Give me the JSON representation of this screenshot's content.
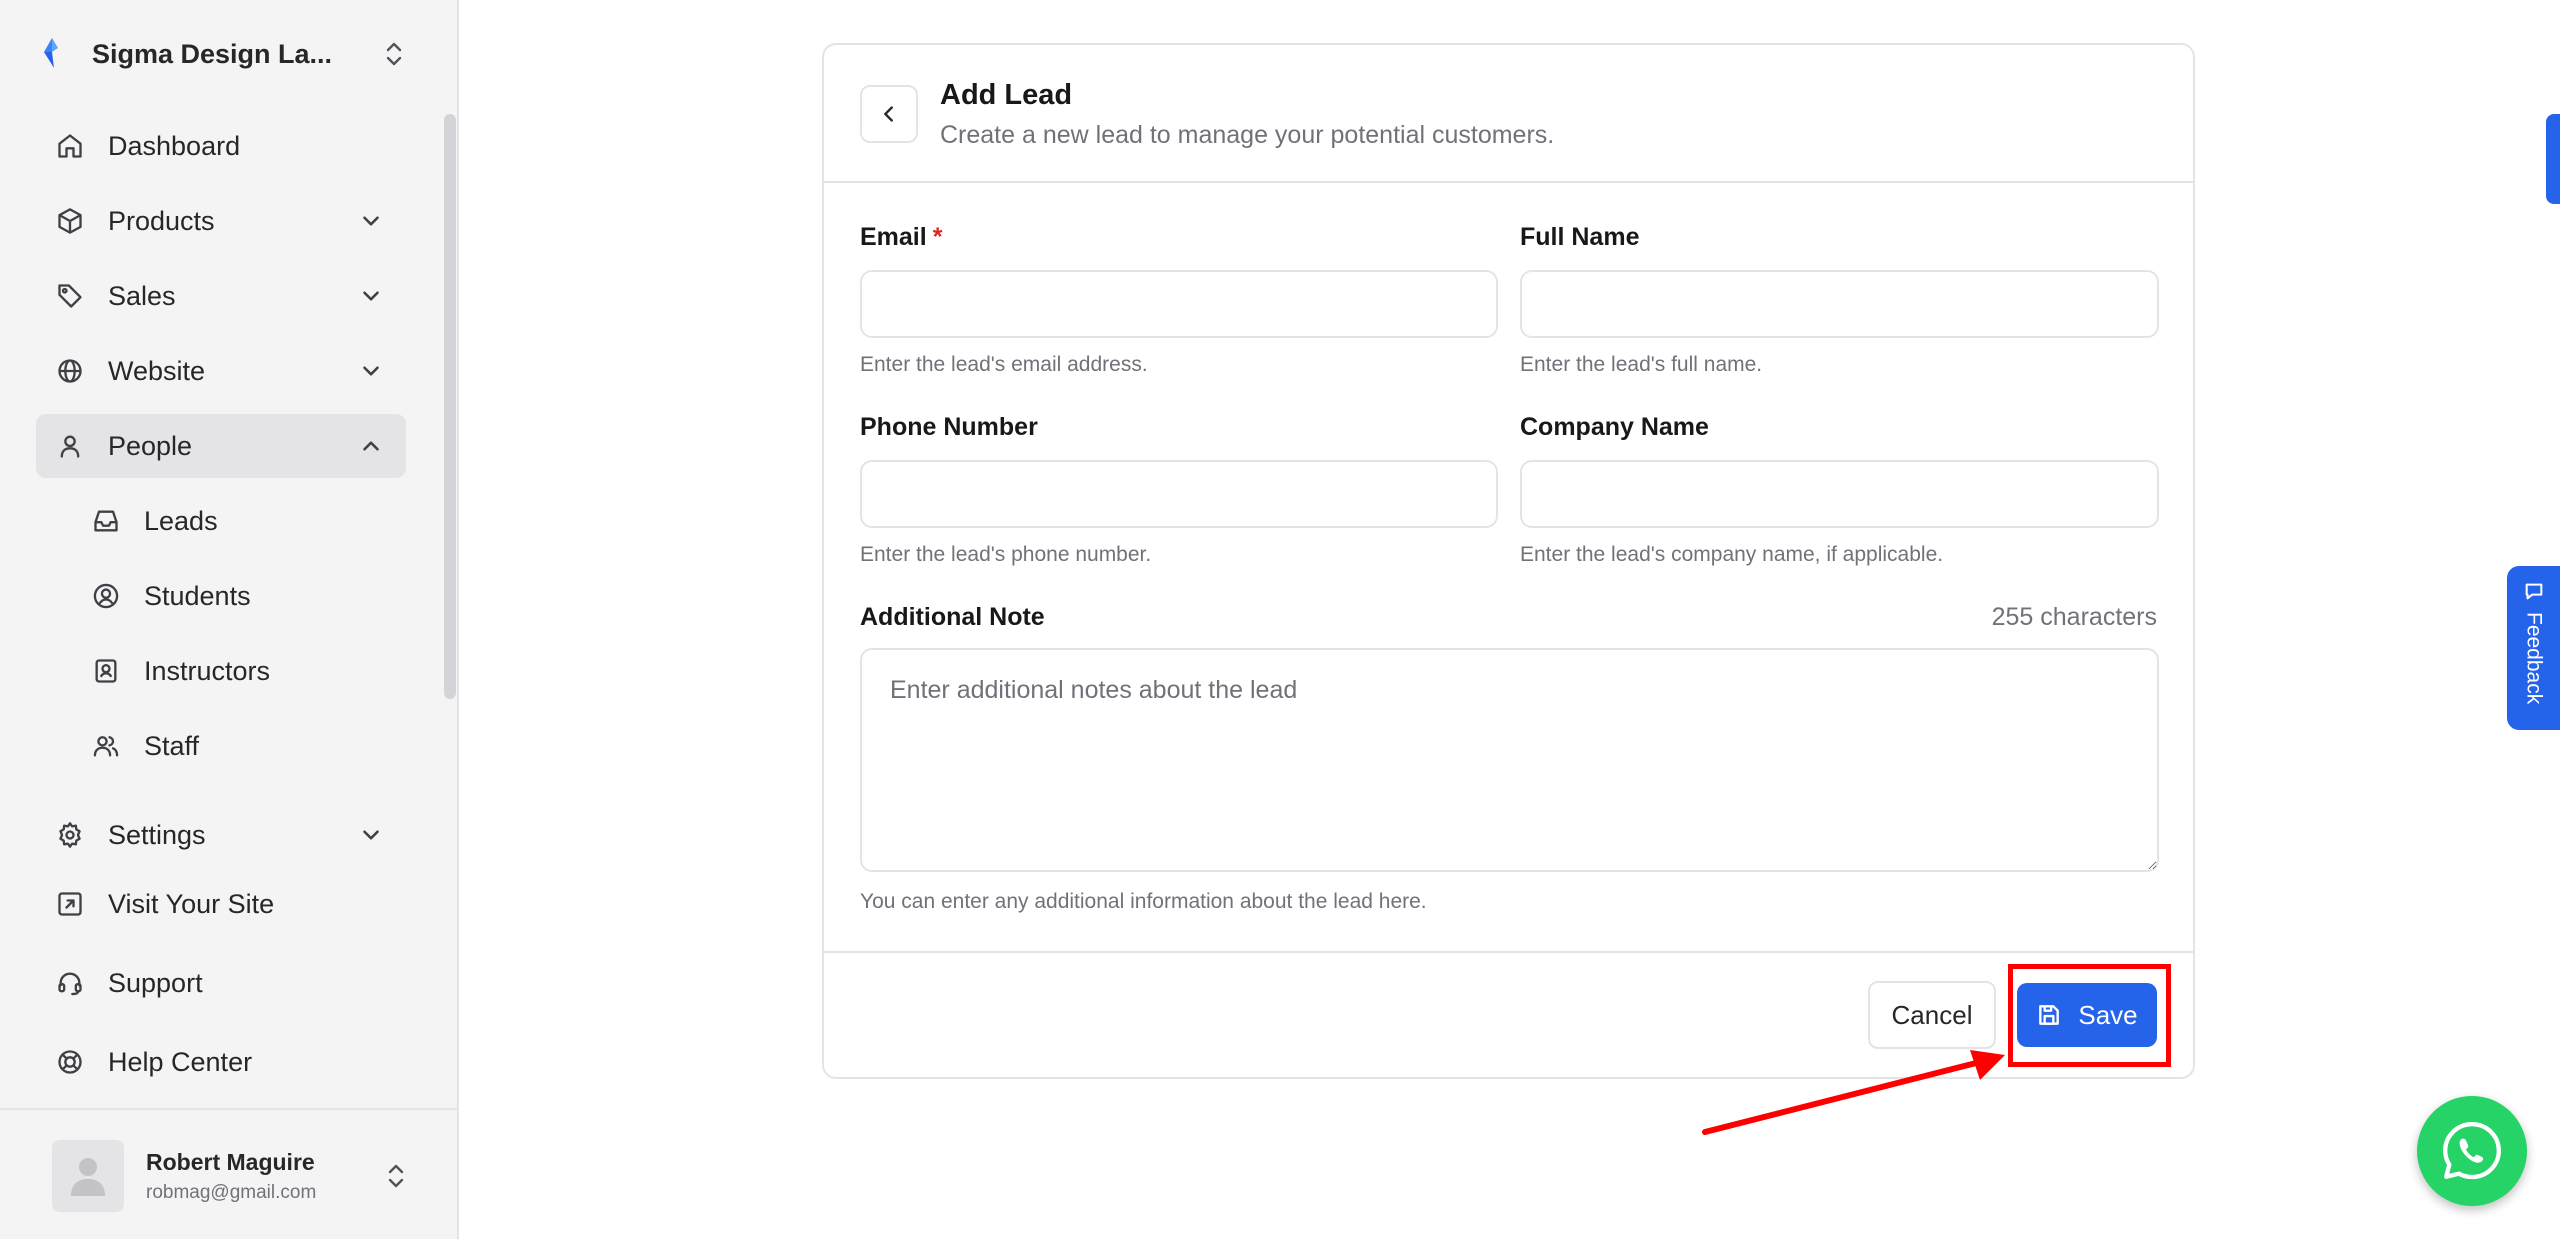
{
  "sidebar": {
    "org_name": "Sigma Design La...",
    "nav": {
      "dashboard": "Dashboard",
      "products": "Products",
      "sales": "Sales",
      "website": "Website",
      "people": "People",
      "leads": "Leads",
      "students": "Students",
      "instructors": "Instructors",
      "staff": "Staff",
      "settings": "Settings",
      "visit_site": "Visit Your Site",
      "support": "Support",
      "help_center": "Help Center"
    },
    "user": {
      "name": "Robert Maguire",
      "email": "robmag@gmail.com"
    }
  },
  "form": {
    "title": "Add Lead",
    "subtitle": "Create a new lead to manage your potential customers.",
    "email": {
      "label": "Email",
      "required_mark": "*",
      "value": "",
      "help": "Enter the lead's email address."
    },
    "full_name": {
      "label": "Full Name",
      "value": "",
      "help": "Enter the lead's full name."
    },
    "phone": {
      "label": "Phone Number",
      "value": "",
      "help": "Enter the lead's phone number."
    },
    "company": {
      "label": "Company Name",
      "value": "",
      "help": "Enter the lead's company name, if applicable."
    },
    "note": {
      "label": "Additional Note",
      "char_count": "255 characters",
      "placeholder": "Enter additional notes about the lead",
      "value": "",
      "help": "You can enter any additional information about the lead here."
    },
    "cancel_label": "Cancel",
    "save_label": "Save"
  },
  "widgets": {
    "feedback_label": "Feedback"
  },
  "colors": {
    "accent": "#2563eb",
    "highlight": "#ff0000",
    "whatsapp": "#25d366",
    "required": "#dc2626"
  },
  "icons": {
    "org_logo": "brand-logo-icon",
    "org_switch": "chevron-up-down-icon",
    "dashboard": "home-icon",
    "products": "box-icon",
    "sales": "tag-icon",
    "website": "globe-icon",
    "people": "user-icon",
    "leads": "inbox-icon",
    "students": "user-circle-icon",
    "instructors": "id-badge-icon",
    "staff": "users-icon",
    "settings": "gear-icon",
    "visit_site": "external-link-icon",
    "support": "headset-icon",
    "help_center": "lifebuoy-icon",
    "back": "chevron-left-icon",
    "save": "floppy-disk-icon",
    "feedback": "chat-bubble-icon",
    "whatsapp": "whatsapp-icon"
  }
}
